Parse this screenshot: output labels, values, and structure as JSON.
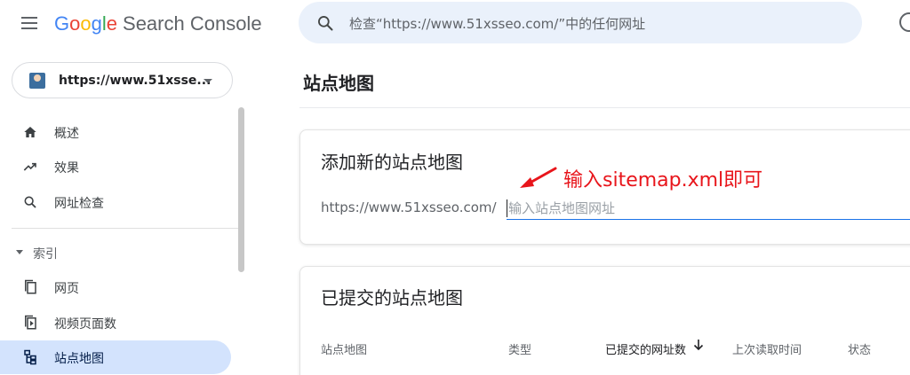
{
  "header": {
    "logo_letters": [
      "G",
      "o",
      "o",
      "g",
      "l",
      "e"
    ],
    "product_name": "Search Console",
    "search_placeholder": "检查“https://www.51xsseo.com/”中的任何网址",
    "icons": {
      "menu": "hamburger-menu-icon",
      "search": "search-icon",
      "help": "help-icon"
    }
  },
  "sidebar": {
    "property": {
      "label": "https://www.51xsse...",
      "avatar": "property-avatar"
    },
    "items": [
      {
        "label": "概述",
        "icon": "home-icon"
      },
      {
        "label": "效果",
        "icon": "trending-up-icon"
      },
      {
        "label": "网址检查",
        "icon": "search-icon"
      }
    ],
    "section": {
      "label": "索引"
    },
    "index_items": [
      {
        "label": "网页",
        "icon": "pages-icon"
      },
      {
        "label": "视频页面数",
        "icon": "video-pages-icon"
      },
      {
        "label": "站点地图",
        "icon": "sitemap-icon",
        "active": true
      }
    ]
  },
  "main": {
    "title": "站点地图",
    "add_card": {
      "title": "添加新的站点地图",
      "prefix": "https://www.51xsseo.com/",
      "input_placeholder": "输入站点地图网址",
      "input_value": ""
    },
    "annotation": {
      "text": "输入sitemap.xml即可",
      "color": "#e8151b"
    },
    "submitted_card": {
      "title": "已提交的站点地图",
      "columns": [
        "站点地图",
        "类型",
        "已提交的网址数",
        "上次读取时间",
        "状态"
      ],
      "sorted_column": "已提交的网址数",
      "sort_direction": "descending"
    }
  },
  "colors": {
    "accent": "#1a73e8",
    "active_nav_bg": "#d3e3fd",
    "search_bg": "#eaf1fb"
  }
}
